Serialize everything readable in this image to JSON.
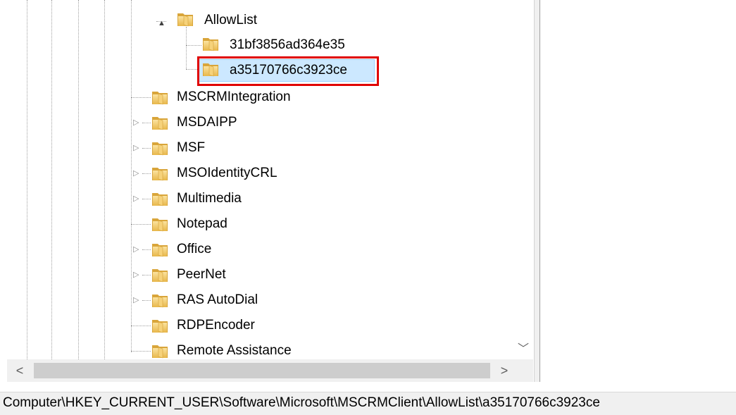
{
  "tree": {
    "items": [
      {
        "label": "AllowList",
        "expander": "▲"
      },
      {
        "label": "31bf3856ad364e35"
      },
      {
        "label": "a35170766c3923ce"
      },
      {
        "label": "MSCRMIntegration"
      },
      {
        "label": "MSDAIPP",
        "expander": "▷"
      },
      {
        "label": "MSF",
        "expander": "▷"
      },
      {
        "label": "MSOIdentityCRL",
        "expander": "▷"
      },
      {
        "label": "Multimedia",
        "expander": "▷"
      },
      {
        "label": "Notepad"
      },
      {
        "label": "Office",
        "expander": "▷"
      },
      {
        "label": "PeerNet",
        "expander": "▷"
      },
      {
        "label": "RAS AutoDial",
        "expander": "▷"
      },
      {
        "label": "RDPEncoder"
      },
      {
        "label": "Remote Assistance"
      }
    ]
  },
  "scrollbar": {
    "left_arrow": "<",
    "right_arrow": ">",
    "down_arrow": "﹀"
  },
  "statusbar": {
    "path": "Computer\\HKEY_CURRENT_USER\\Software\\Microsoft\\MSCRMClient\\AllowList\\a35170766c3923ce"
  },
  "colors": {
    "highlight_border": "#e00000",
    "folder": "#e8b74a"
  }
}
